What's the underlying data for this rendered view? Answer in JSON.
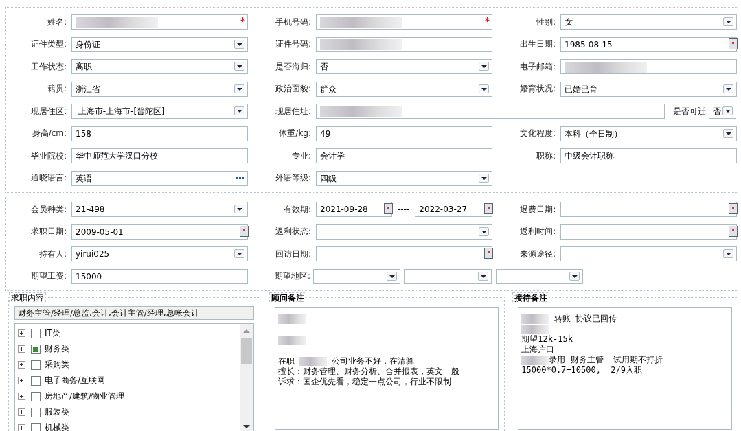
{
  "basic_info": {
    "rows": [
      [
        {
          "label": "姓名:",
          "kind": "text",
          "blurred": true,
          "required": true
        },
        {
          "label": "手机号码:",
          "kind": "text",
          "blurred": true,
          "required": true
        },
        {
          "label": "性别:",
          "kind": "select",
          "value": "女"
        }
      ],
      [
        {
          "label": "证件类型:",
          "kind": "select",
          "value": "身份证"
        },
        {
          "label": "证件号码:",
          "kind": "text",
          "blurred": true
        },
        {
          "label": "出生日期:",
          "kind": "date",
          "value": "1985-08-15"
        }
      ],
      [
        {
          "label": "工作状态:",
          "kind": "select",
          "value": "离职"
        },
        {
          "label": "是否海归:",
          "kind": "select",
          "value": "否"
        },
        {
          "label": "电子邮箱:",
          "kind": "text",
          "blurred": true
        }
      ],
      [
        {
          "label": "籍贯:",
          "kind": "select",
          "value": "浙江省"
        },
        {
          "label": "政治面貌:",
          "kind": "select",
          "value": "群众"
        },
        {
          "label": "婚育状况:",
          "kind": "select",
          "value": "已婚已育"
        }
      ],
      [
        {
          "label": "现居住区:",
          "kind": "select",
          "value": " 上海市-上海市-[普陀区]"
        },
        {
          "label": "现居住址:",
          "kind": "wide-text",
          "blurred": true
        },
        {
          "label": "是否可迁",
          "kind": "mini-select",
          "value": "否"
        }
      ],
      [
        {
          "label": "身高/cm:",
          "kind": "text",
          "value": "158"
        },
        {
          "label": "体重/kg:",
          "kind": "text",
          "value": "49"
        },
        {
          "label": "文化程度:",
          "kind": "select",
          "value": "本科（全日制）"
        }
      ],
      [
        {
          "label": "毕业院校:",
          "kind": "text",
          "value": "华中师范大学汉口分校"
        },
        {
          "label": "专业:",
          "kind": "text",
          "value": "会计学"
        },
        {
          "label": "职称:",
          "kind": "text",
          "value": "中级会计职称"
        }
      ],
      [
        {
          "label": "通晓语言:",
          "kind": "lookup",
          "value": "英语"
        },
        {
          "label": "外语等级:",
          "kind": "select",
          "value": "四级"
        }
      ]
    ]
  },
  "membership": {
    "rows": [
      [
        {
          "label": "会员种类:",
          "kind": "select",
          "value": "21-498"
        },
        {
          "label": "有效期:",
          "kind": "date-range",
          "value": "2021-09-28",
          "separator": "----",
          "value_end": "2022-03-27"
        },
        {
          "label": "退费日期:",
          "kind": "date"
        }
      ],
      [
        {
          "label": "求职日期:",
          "kind": "date",
          "value": "2009-05-01"
        },
        {
          "label": "返利状态:",
          "kind": "select"
        },
        {
          "label": "返利时间:",
          "kind": "date"
        }
      ],
      [
        {
          "label": "持有人:",
          "kind": "select",
          "value": "yirui025"
        },
        {
          "label": "回访日期:",
          "kind": "date"
        },
        {
          "label": "来源途径:",
          "kind": "select"
        }
      ],
      [
        {
          "label": "期望工资:",
          "kind": "text",
          "value": "15000"
        },
        {
          "label": "期望地区:",
          "kind": "multi-select"
        }
      ]
    ]
  },
  "job_intent": {
    "title": "求职内容",
    "summary": "财务主管/经理/总监,会计,会计主管/经理,总帐会计",
    "categories": [
      {
        "label": "IT类",
        "checked": false
      },
      {
        "label": "财务类",
        "checked": true
      },
      {
        "label": "采购类",
        "checked": false
      },
      {
        "label": "电子商务/互联网",
        "checked": false
      },
      {
        "label": "房地产/建筑/物业管理",
        "checked": false
      },
      {
        "label": "服装类",
        "checked": false
      },
      {
        "label": "机械类",
        "checked": false
      }
    ]
  },
  "consultant_notes": {
    "title": "顾问备注",
    "lines": [
      [
        {
          "kind": "blur"
        }
      ],
      [
        {
          "kind": "blur"
        }
      ],
      [
        {
          "kind": "text",
          "text": "在职 "
        },
        {
          "kind": "blur"
        },
        {
          "kind": "text",
          "text": " 公司业务不好，在清算"
        }
      ],
      [
        {
          "kind": "text",
          "text": "擅长：财务管理、财务分析、合并报表，英文一般"
        }
      ],
      [
        {
          "kind": "text",
          "text": "诉求：国企优先看，稳定一点公司，行业不限制"
        }
      ]
    ]
  },
  "reception_notes": {
    "title": "接待备注",
    "lines": [
      [
        {
          "kind": "blur"
        },
        {
          "kind": "text",
          "text": " 转账 协议已回传"
        }
      ],
      [
        {
          "kind": "blur"
        }
      ],
      [
        {
          "kind": "text",
          "text": "期望12k-15k"
        }
      ],
      [
        {
          "kind": "text",
          "text": "上海户口"
        }
      ],
      [
        {
          "kind": "blur"
        },
        {
          "kind": "text",
          "text": "录用 财务主管  试用期不打折"
        }
      ],
      [
        {
          "kind": "text",
          "text": "15000*0.7=10500,  2/9入职"
        }
      ]
    ]
  }
}
